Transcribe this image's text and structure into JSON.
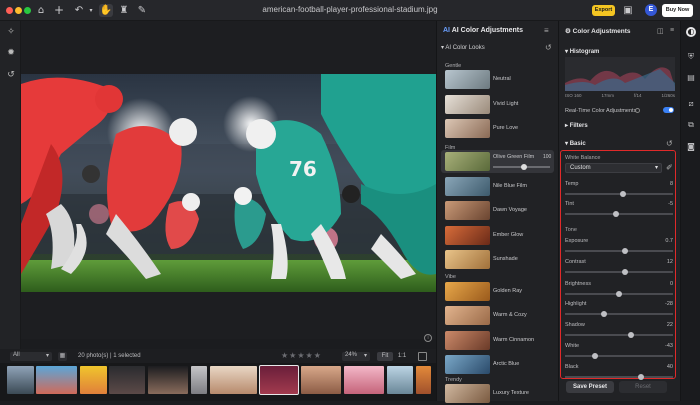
{
  "titlebar": {
    "file_title": "american-football-player-professional-stadium.jpg",
    "export_label": "Export",
    "avatar_letter": "E",
    "buy_label": "Buy Now"
  },
  "bottombar": {
    "filter_value": "All",
    "photo_count": "20 photo(s) | 1 selected",
    "zoom": "24%",
    "fit_label": "Fit",
    "one_to_one": "1:1"
  },
  "ai_panel": {
    "title": "AI Color Adjustments",
    "looks_header": "AI Color Looks",
    "groups": [
      {
        "label": "Gentle",
        "items": [
          "Neutral",
          "Vivid Light",
          "Pure Love"
        ]
      },
      {
        "label": "Film",
        "items": [
          "Olive Green Film",
          "Nile Blue Film",
          "Dawn Voyage",
          "Ember Glow",
          "Sunshade"
        ]
      },
      {
        "label": "Vibe",
        "items": [
          "Golden Ray",
          "Warm & Cozy",
          "Warm Cinnamon",
          "Arctic Blue"
        ]
      },
      {
        "label": "Trendy",
        "items": [
          "Luxury Texture"
        ]
      }
    ],
    "selected_value": "100"
  },
  "right_panel": {
    "title": "Color Adjustments",
    "histogram_title": "Histogram",
    "exif": [
      "ISO 160",
      "17mm",
      "f/14",
      "1/260s"
    ],
    "realtime_label": "Real-Time Color Adjustments",
    "filters_label": "Filters",
    "basic_label": "Basic",
    "white_balance_label": "White Balance",
    "white_balance_value": "Custom",
    "tone_label": "Tone",
    "save_preset": "Save Preset",
    "reset_label": "Reset"
  },
  "sliders": {
    "temp": {
      "label": "Temp",
      "value": "8",
      "level": 0.54
    },
    "tint": {
      "label": "Tint",
      "value": "-5",
      "level": 0.47
    },
    "exposure": {
      "label": "Exposure",
      "value": "0.7",
      "level": 0.56
    },
    "contrast": {
      "label": "Contrast",
      "value": "12",
      "level": 0.56
    },
    "brightness": {
      "label": "Brightness",
      "value": "0",
      "level": 0.5
    },
    "highlight": {
      "label": "Highlight",
      "value": "-28",
      "level": 0.36
    },
    "shadow": {
      "label": "Shadow",
      "value": "22",
      "level": 0.61
    },
    "white": {
      "label": "White",
      "value": "-43",
      "level": 0.28
    },
    "black": {
      "label": "Black",
      "value": "40",
      "level": 0.7
    }
  },
  "colors": {
    "accent": "#f4c522",
    "toggle": "#3b82f6",
    "highlight_box": "#e02a2a",
    "avatar": "#3457d5"
  }
}
